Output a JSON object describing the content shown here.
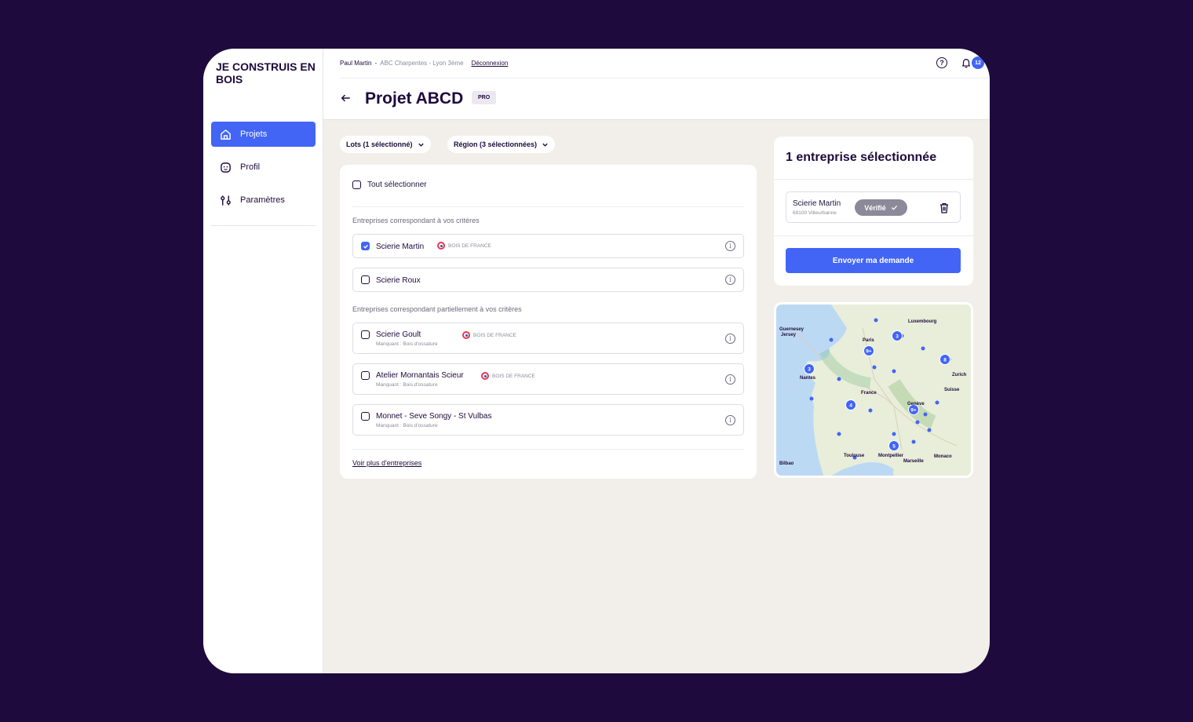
{
  "app": {
    "logo": "JE CONSTRUIS EN BOIS"
  },
  "sidebar": {
    "items": [
      {
        "label": "Projets",
        "icon": "home-icon",
        "active": true
      },
      {
        "label": "Profil",
        "icon": "face-icon",
        "active": false
      },
      {
        "label": "Paramètres",
        "icon": "sliders-icon",
        "active": false
      }
    ]
  },
  "header": {
    "user_name": "Paul Martin",
    "user_company": "ABC Charpentes - Lyon 3ème",
    "logout": "Déconnexion",
    "help": "?",
    "notifications": "12"
  },
  "page": {
    "title": "Projet ABCD",
    "tag": "PRO"
  },
  "filters": {
    "lots": "Lots (1 sélectionné)",
    "region": "Région (3 sélectionnées)"
  },
  "list": {
    "select_all": "Tout sélectionner",
    "section_full": "Entreprises correspondant à vos critères",
    "section_partial": "Entreprises correspondant partiellement à vos critères",
    "label_bdf": "BOIS DE FRANCE",
    "companies": [
      {
        "name": "Scierie Martin",
        "checked": true,
        "bdf": true,
        "missing": ""
      },
      {
        "name": "Scierie Roux",
        "checked": false,
        "bdf": false,
        "missing": ""
      },
      {
        "name": "Scierie Goult",
        "checked": false,
        "bdf": true,
        "missing": "Manquant : Bois d'ossature"
      },
      {
        "name": "Atelier Mornantais Scieur",
        "checked": false,
        "bdf": true,
        "missing": "Manquant : Bois d'ossature"
      },
      {
        "name": "Monnet - Seve Songy -  St Vulbas",
        "checked": false,
        "bdf": false,
        "missing": "Manquant : Bois d'ossature"
      }
    ],
    "more_link": "Voir plus d'entreprises"
  },
  "selection": {
    "title": "1 entreprise sélectionnée",
    "item_name": "Scierie Martin",
    "item_address": "69100 Villeurbanne",
    "verified": "Vérifié",
    "button": "Envoyer ma demande"
  },
  "map": {
    "labels": [
      "Luxembourg",
      "Paris",
      "France",
      "Nantes",
      "Suisse",
      "Monaco",
      "Toulouse",
      "Montpellier",
      "Marseille",
      "Genève",
      "Zurich",
      "Guernesey",
      "Jersey",
      "Bilbao"
    ],
    "clusters": [
      "3",
      "9+",
      "8",
      "3",
      "4",
      "9+",
      "5"
    ]
  },
  "colors": {
    "primary": "#4265f6",
    "background": "#1e0a3c",
    "page": "#f2efeb"
  }
}
